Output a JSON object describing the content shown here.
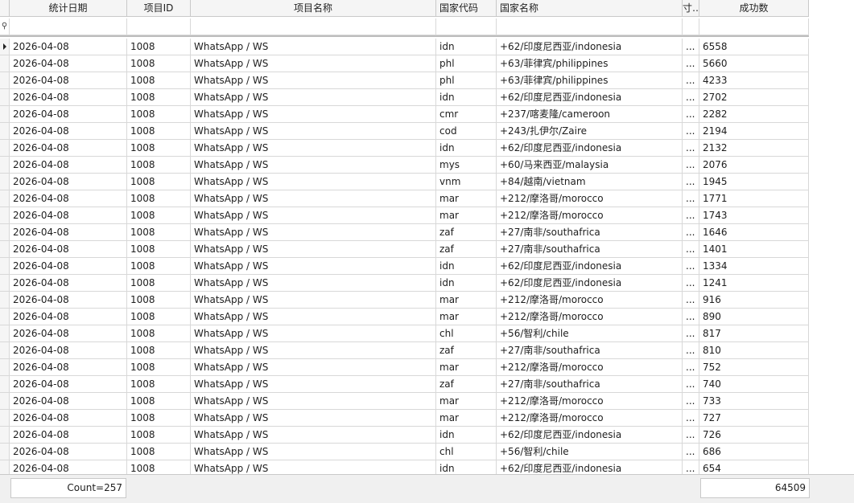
{
  "columns": {
    "date": "统计日期",
    "project_id": "项目ID",
    "project_name": "项目名称",
    "country_code": "国家代码",
    "country_name": "国家名称",
    "narrow": "寸…",
    "success": "成功数"
  },
  "filter_icon": "filter-pin-icon",
  "rows": [
    {
      "date": "2026-04-08",
      "pid": "1008",
      "pname": "WhatsApp / WS",
      "code": "idn",
      "country": "+62/印度尼西亚/indonesia",
      "n": "...",
      "success": "6558"
    },
    {
      "date": "2026-04-08",
      "pid": "1008",
      "pname": "WhatsApp / WS",
      "code": "phl",
      "country": "+63/菲律宾/philippines",
      "n": "...",
      "success": "5660"
    },
    {
      "date": "2026-04-08",
      "pid": "1008",
      "pname": "WhatsApp / WS",
      "code": "phl",
      "country": "+63/菲律宾/philippines",
      "n": "...",
      "success": "4233"
    },
    {
      "date": "2026-04-08",
      "pid": "1008",
      "pname": "WhatsApp / WS",
      "code": "idn",
      "country": "+62/印度尼西亚/indonesia",
      "n": "...",
      "success": "2702"
    },
    {
      "date": "2026-04-08",
      "pid": "1008",
      "pname": "WhatsApp / WS",
      "code": "cmr",
      "country": "+237/喀麦隆/cameroon",
      "n": "...",
      "success": "2282"
    },
    {
      "date": "2026-04-08",
      "pid": "1008",
      "pname": "WhatsApp / WS",
      "code": "cod",
      "country": "+243/扎伊尔/Zaire",
      "n": "...",
      "success": "2194"
    },
    {
      "date": "2026-04-08",
      "pid": "1008",
      "pname": "WhatsApp / WS",
      "code": "idn",
      "country": "+62/印度尼西亚/indonesia",
      "n": "...",
      "success": "2132"
    },
    {
      "date": "2026-04-08",
      "pid": "1008",
      "pname": "WhatsApp / WS",
      "code": "mys",
      "country": "+60/马来西亚/malaysia",
      "n": "...",
      "success": "2076"
    },
    {
      "date": "2026-04-08",
      "pid": "1008",
      "pname": "WhatsApp / WS",
      "code": "vnm",
      "country": "+84/越南/vietnam",
      "n": "...",
      "success": "1945"
    },
    {
      "date": "2026-04-08",
      "pid": "1008",
      "pname": "WhatsApp / WS",
      "code": "mar",
      "country": "+212/摩洛哥/morocco",
      "n": "...",
      "success": "1771"
    },
    {
      "date": "2026-04-08",
      "pid": "1008",
      "pname": "WhatsApp / WS",
      "code": "mar",
      "country": "+212/摩洛哥/morocco",
      "n": "...",
      "success": "1743"
    },
    {
      "date": "2026-04-08",
      "pid": "1008",
      "pname": "WhatsApp / WS",
      "code": "zaf",
      "country": "+27/南非/southafrica",
      "n": "...",
      "success": "1646"
    },
    {
      "date": "2026-04-08",
      "pid": "1008",
      "pname": "WhatsApp / WS",
      "code": "zaf",
      "country": "+27/南非/southafrica",
      "n": "...",
      "success": "1401"
    },
    {
      "date": "2026-04-08",
      "pid": "1008",
      "pname": "WhatsApp / WS",
      "code": "idn",
      "country": "+62/印度尼西亚/indonesia",
      "n": "...",
      "success": "1334"
    },
    {
      "date": "2026-04-08",
      "pid": "1008",
      "pname": "WhatsApp / WS",
      "code": "idn",
      "country": "+62/印度尼西亚/indonesia",
      "n": "...",
      "success": "1241"
    },
    {
      "date": "2026-04-08",
      "pid": "1008",
      "pname": "WhatsApp / WS",
      "code": "mar",
      "country": "+212/摩洛哥/morocco",
      "n": "...",
      "success": "916"
    },
    {
      "date": "2026-04-08",
      "pid": "1008",
      "pname": "WhatsApp / WS",
      "code": "mar",
      "country": "+212/摩洛哥/morocco",
      "n": "...",
      "success": "890"
    },
    {
      "date": "2026-04-08",
      "pid": "1008",
      "pname": "WhatsApp / WS",
      "code": "chl",
      "country": "+56/智利/chile",
      "n": "...",
      "success": "817"
    },
    {
      "date": "2026-04-08",
      "pid": "1008",
      "pname": "WhatsApp / WS",
      "code": "zaf",
      "country": "+27/南非/southafrica",
      "n": "...",
      "success": "810"
    },
    {
      "date": "2026-04-08",
      "pid": "1008",
      "pname": "WhatsApp / WS",
      "code": "mar",
      "country": "+212/摩洛哥/morocco",
      "n": "...",
      "success": "752"
    },
    {
      "date": "2026-04-08",
      "pid": "1008",
      "pname": "WhatsApp / WS",
      "code": "zaf",
      "country": "+27/南非/southafrica",
      "n": "...",
      "success": "740"
    },
    {
      "date": "2026-04-08",
      "pid": "1008",
      "pname": "WhatsApp / WS",
      "code": "mar",
      "country": "+212/摩洛哥/morocco",
      "n": "...",
      "success": "733"
    },
    {
      "date": "2026-04-08",
      "pid": "1008",
      "pname": "WhatsApp / WS",
      "code": "mar",
      "country": "+212/摩洛哥/morocco",
      "n": "...",
      "success": "727"
    },
    {
      "date": "2026-04-08",
      "pid": "1008",
      "pname": "WhatsApp / WS",
      "code": "idn",
      "country": "+62/印度尼西亚/indonesia",
      "n": "...",
      "success": "726"
    },
    {
      "date": "2026-04-08",
      "pid": "1008",
      "pname": "WhatsApp / WS",
      "code": "chl",
      "country": "+56/智利/chile",
      "n": "...",
      "success": "686"
    },
    {
      "date": "2026-04-08",
      "pid": "1008",
      "pname": "WhatsApp / WS",
      "code": "idn",
      "country": "+62/印度尼西亚/indonesia",
      "n": "...",
      "success": "654"
    }
  ],
  "footer": {
    "count_label": "Count=257",
    "success_total": "64509"
  }
}
